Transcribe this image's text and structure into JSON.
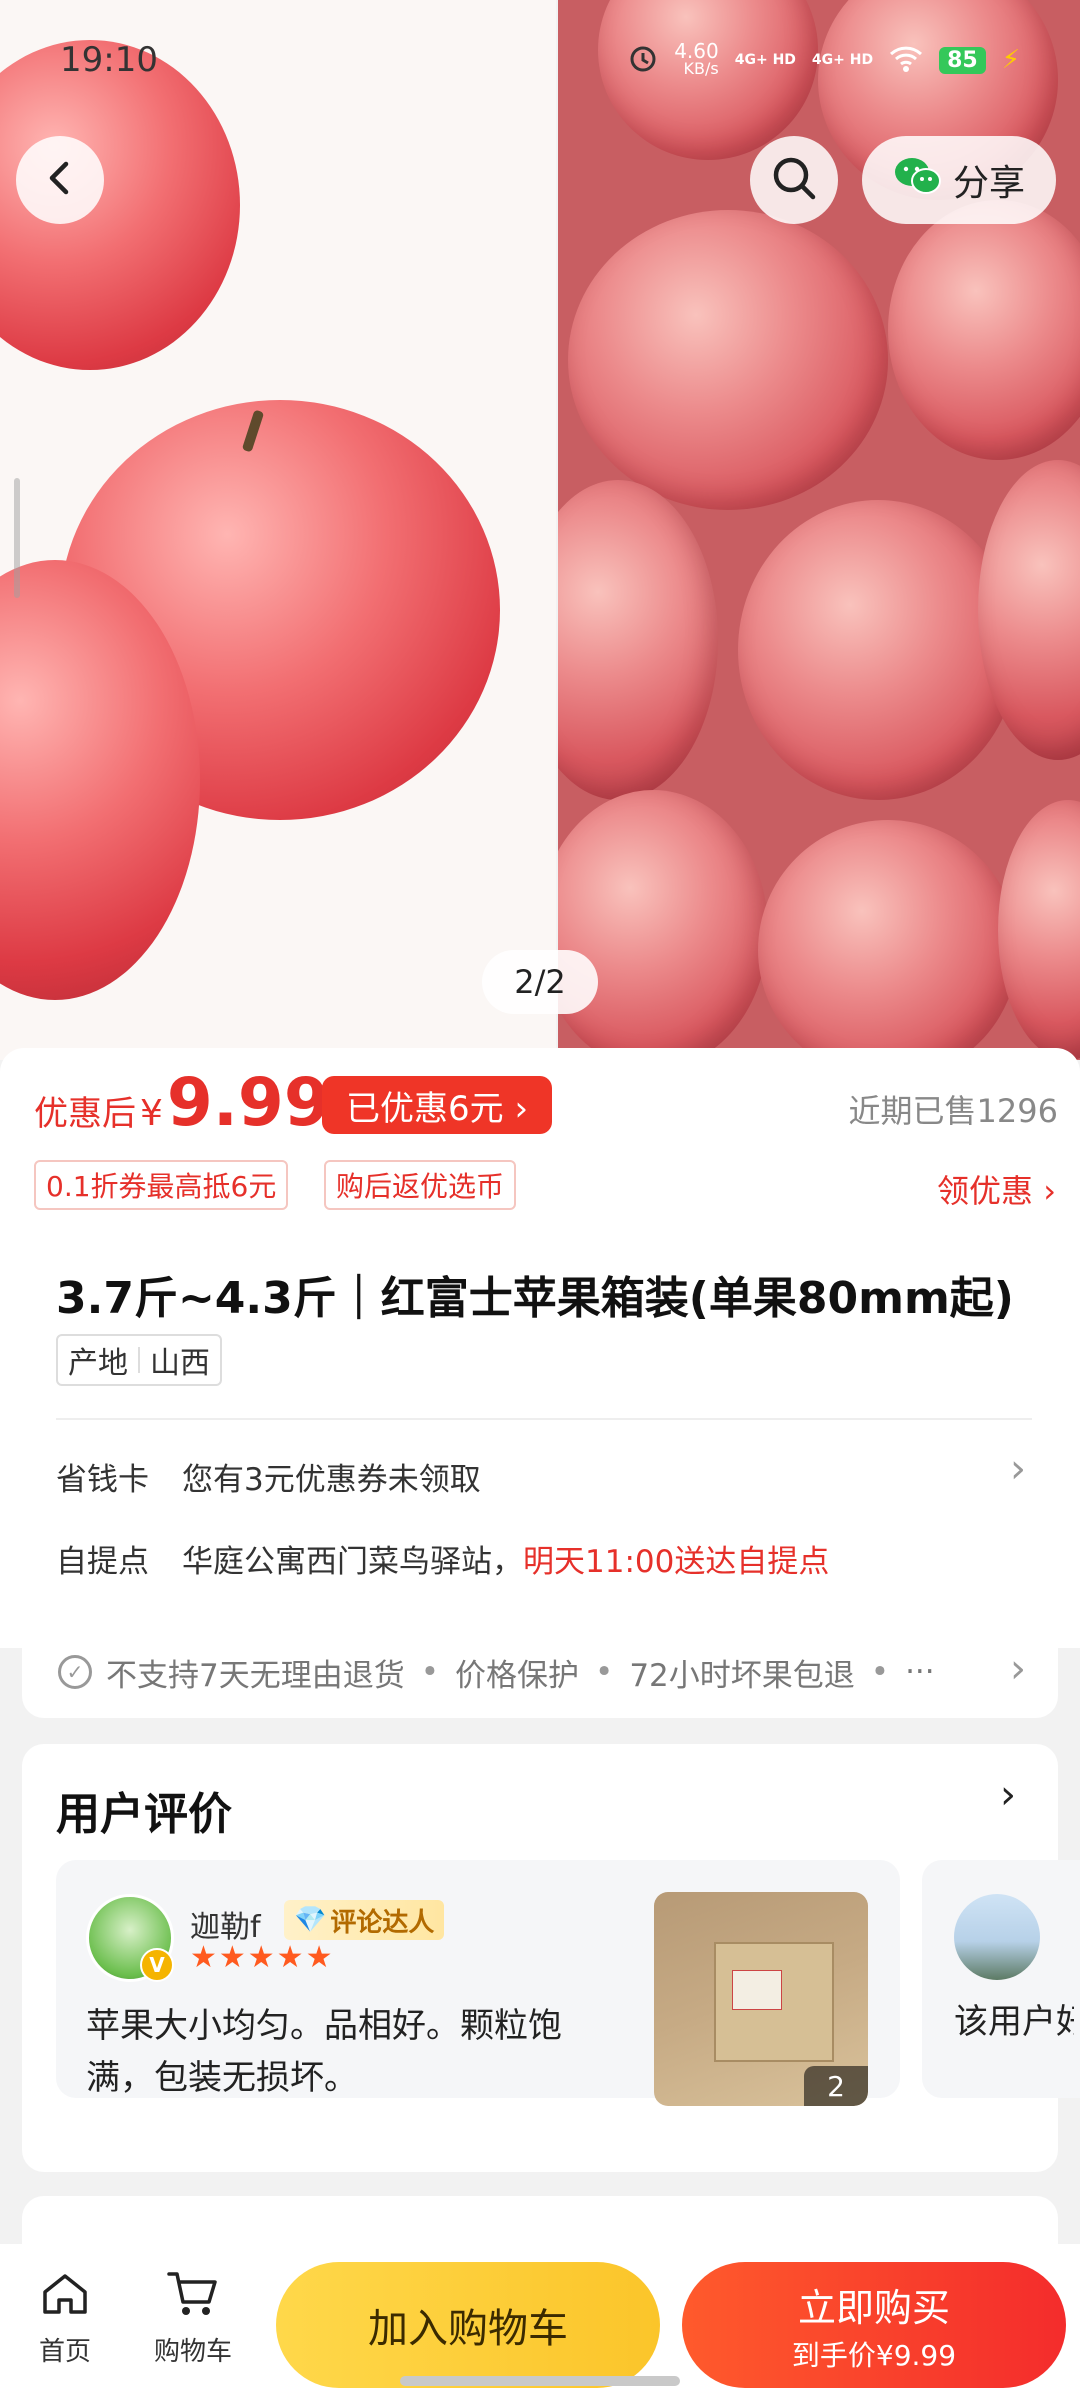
{
  "status_bar": {
    "time": "19:10",
    "speed_value": "4.60",
    "speed_unit": "KB/s",
    "signal_1": "4G+ HD",
    "signal_2": "4G+ HD",
    "battery": "85"
  },
  "gallery": {
    "page_indicator": "2/2"
  },
  "header": {
    "share_label": "分享"
  },
  "price": {
    "prefix": "优惠后",
    "currency": "¥",
    "value": "9.99",
    "saved_label": "已优惠6元 ›",
    "sold_label": "近期已售1296"
  },
  "tags": {
    "coupon_tag": "0.1折券最高抵6元",
    "rebate_tag": "购后返优选币",
    "get_coupon": "领优惠 ›"
  },
  "product": {
    "title": "3.7斤~4.3斤｜红富士苹果箱装(单果80mm起)",
    "origin_label": "产地",
    "origin_value": "山西"
  },
  "rows": {
    "savings_label": "省钱卡",
    "savings_text": "您有3元优惠券未领取",
    "pickup_label": "自提点",
    "pickup_text": "华庭公寓西门菜鸟驿站，",
    "pickup_eta": "明天11:00送达自提点"
  },
  "guarantee": {
    "item1": "不支持7天无理由退货",
    "item2": "价格保护",
    "item3": "72小时坏果包退",
    "more": "···"
  },
  "reviews": {
    "title": "用户评价",
    "items": [
      {
        "user": "迦勒f",
        "badge": "评论达人",
        "stars": "★★★★★",
        "text": "苹果大小均匀。品相好。颗粒饱满，包装无损坏。",
        "photo_count": "2"
      },
      {
        "text": "该用户好评"
      }
    ]
  },
  "bottom_nav": {
    "home": "首页",
    "cart": "购物车",
    "add_to_cart": "加入购物车",
    "buy_now": "立即购买",
    "final_price": "到手价¥9.99"
  },
  "icons": {
    "back": "chevron-left-icon",
    "search": "search-icon",
    "wechat": "wechat-icon",
    "home": "home-icon",
    "cart": "cart-icon"
  },
  "colors": {
    "accent_red": "#e6302a",
    "buy_gradient": "#f42c2c",
    "cart_yellow": "#fbc52a"
  }
}
